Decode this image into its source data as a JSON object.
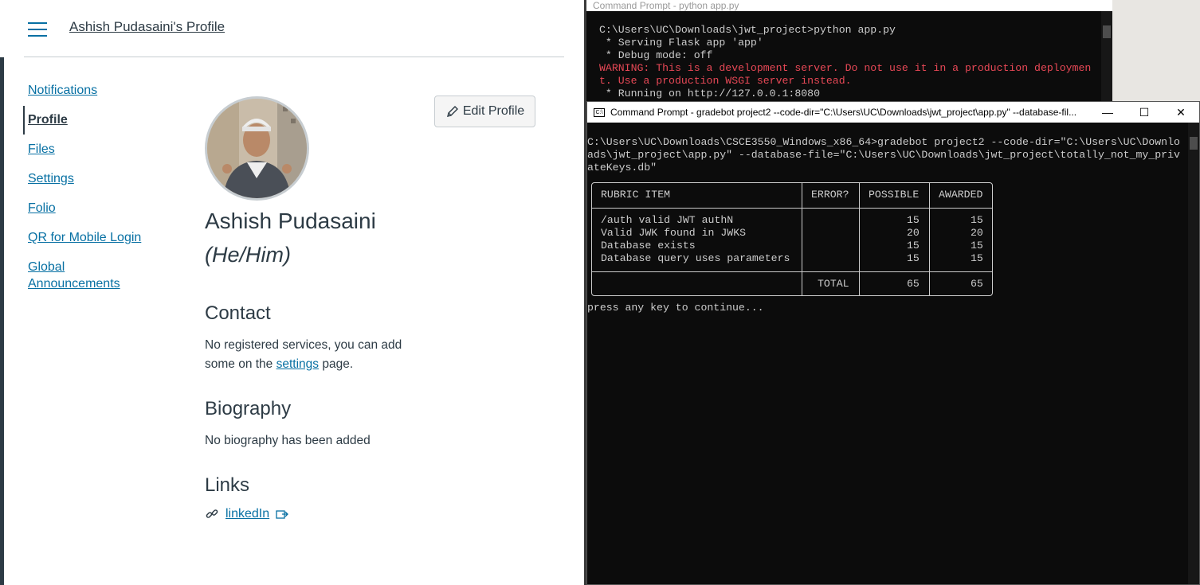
{
  "profile_page": {
    "breadcrumb": "Ashish Pudasaini's Profile",
    "nav": [
      "Notifications",
      "Profile",
      "Files",
      "Settings",
      "Folio",
      "QR for Mobile Login",
      "Global",
      "Announcements"
    ],
    "edit_button": "Edit Profile",
    "name": "Ashish Pudasaini",
    "pronouns": "(He/Him)",
    "contact_heading": "Contact",
    "contact_text_1": "No registered services, you can add",
    "contact_text_2a": "some on the ",
    "contact_link": "settings",
    "contact_text_2b": " page.",
    "bio_heading": "Biography",
    "bio_text": "No biography has been added",
    "links_heading": "Links",
    "link_label": "linkedIn"
  },
  "terminal_back": {
    "title": "Command Prompt - python app.py",
    "lines": [
      "C:\\Users\\UC\\Downloads\\jwt_project>python app.py",
      " * Serving Flask app 'app'",
      " * Debug mode: off"
    ],
    "warning_1": "WARNING: This is a development server. Do not use it in a production deploymen",
    "warning_2": "t. Use a production WSGI server instead.",
    "running": " * Running on http://127.0.0.1:8080"
  },
  "terminal_front": {
    "title": "Command Prompt - gradebot  project2 --code-dir=\"C:\\Users\\UC\\Downloads\\jwt_project\\app.py\" --database-fil...",
    "cmd_lines": [
      "C:\\Users\\UC\\Downloads\\CSCE3550_Windows_x86_64>gradebot project2 --code-dir=\"C:\\Users\\UC\\Downlo",
      "ads\\jwt_project\\app.py\" --database-file=\"C:\\Users\\UC\\Downloads\\jwt_project\\totally_not_my_priv",
      "ateKeys.db\""
    ],
    "headers": [
      "RUBRIC ITEM",
      "ERROR?",
      "POSSIBLE",
      "AWARDED"
    ],
    "rows": [
      {
        "item": "/auth valid JWT authN",
        "possible": "15",
        "awarded": "15"
      },
      {
        "item": "Valid JWK found in JWKS",
        "possible": "20",
        "awarded": "20"
      },
      {
        "item": "Database exists",
        "possible": "15",
        "awarded": "15"
      },
      {
        "item": "Database query uses parameters",
        "possible": "15",
        "awarded": "15"
      }
    ],
    "total_label": "TOTAL",
    "total_possible": "65",
    "total_awarded": "65",
    "prompt": "press any key to continue..."
  },
  "window_controls": {
    "min": "—",
    "max": "☐",
    "close": "✕"
  },
  "colors": {
    "link": "#0770a3",
    "text": "#2d3b45",
    "warning": "#e74856",
    "terminal_bg": "#0c0c0c"
  }
}
